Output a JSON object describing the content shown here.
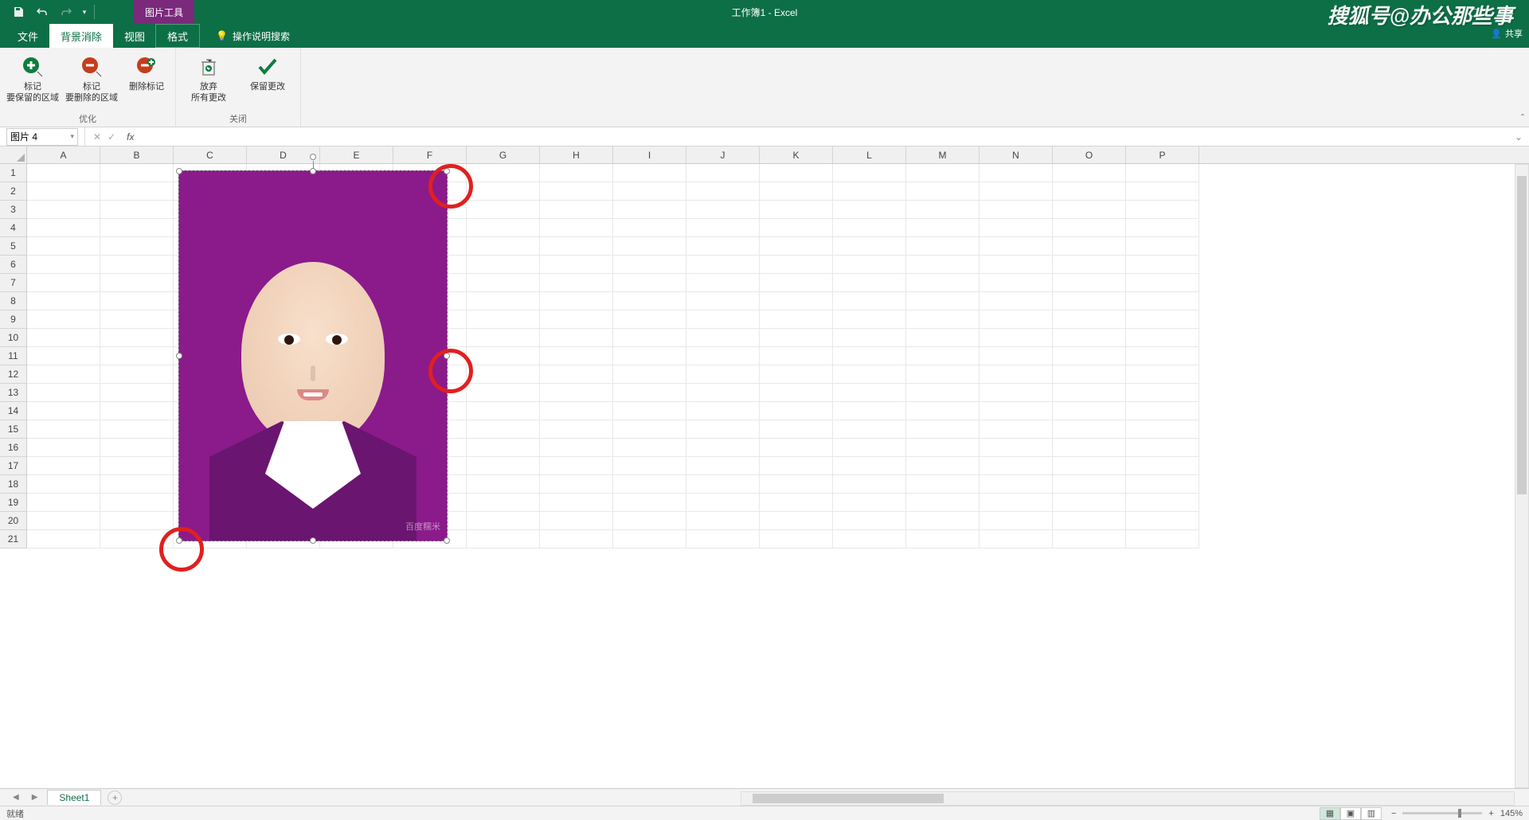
{
  "titlebar": {
    "contextual_tab": "图片工具",
    "doc_title": "工作簿1 - Excel",
    "watermark": "搜狐号@办公那些事"
  },
  "tabs": {
    "file": "文件",
    "bgremove": "背景消除",
    "view": "视图",
    "format": "格式",
    "tellme": "操作说明搜索"
  },
  "ribbon": {
    "mark_keep": {
      "l1": "标记",
      "l2": "要保留的区域"
    },
    "mark_remove": {
      "l1": "标记",
      "l2": "要删除的区域"
    },
    "delete_mark": {
      "l1": "删除标记"
    },
    "group1": "优化",
    "discard": {
      "l1": "放弃",
      "l2": "所有更改"
    },
    "keep": {
      "l1": "保留更改"
    },
    "group2": "关闭"
  },
  "share": "共享",
  "namebox": "图片 4",
  "columns": [
    "A",
    "B",
    "C",
    "D",
    "E",
    "F",
    "G",
    "H",
    "I",
    "J",
    "K",
    "L",
    "M",
    "N",
    "O",
    "P"
  ],
  "rows": [
    "1",
    "2",
    "3",
    "4",
    "5",
    "6",
    "7",
    "8",
    "9",
    "10",
    "11",
    "12",
    "13",
    "14",
    "15",
    "16",
    "17",
    "18",
    "19",
    "20",
    "21"
  ],
  "image_watermark": "百度糯米",
  "sheet": "Sheet1",
  "status": {
    "ready": "就绪",
    "zoom": "145%"
  }
}
